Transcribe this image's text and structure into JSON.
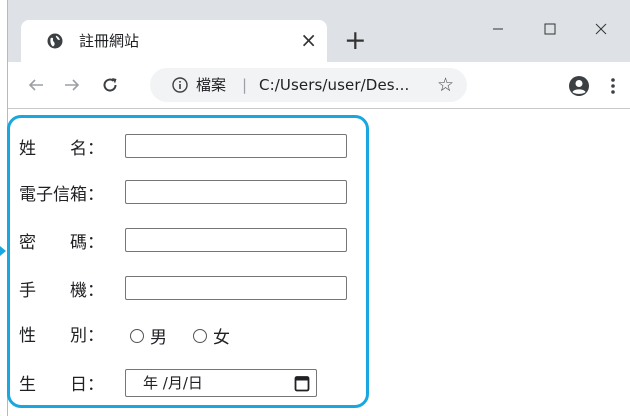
{
  "tab": {
    "title": "註冊網站",
    "close_glyph": "×",
    "favicon": "globe-icon"
  },
  "new_tab_glyph": "+",
  "window_controls": {
    "minimize": "–",
    "maximize": "□",
    "close": "×"
  },
  "toolbar": {
    "back": "←",
    "forward": "→",
    "reload": "C",
    "info_glyph": "ⓘ",
    "chip_label": "檔案",
    "separator": "|",
    "url": "C:/Users/user/Des...",
    "star_glyph": "☆"
  },
  "form": {
    "name_label": "姓　　名：",
    "email_label": "電子信箱：",
    "password_label": "密　　碼：",
    "phone_label": "手　　機：",
    "gender_label": "性　　別：",
    "gender_options": [
      "男",
      "女"
    ],
    "birthday_label": "生　　日：",
    "birthday_placeholder": "年 /月/日"
  },
  "colors": {
    "highlight": "#1aa7df",
    "tabstrip": "#dee1e6",
    "omnibox": "#f1f3f4"
  }
}
